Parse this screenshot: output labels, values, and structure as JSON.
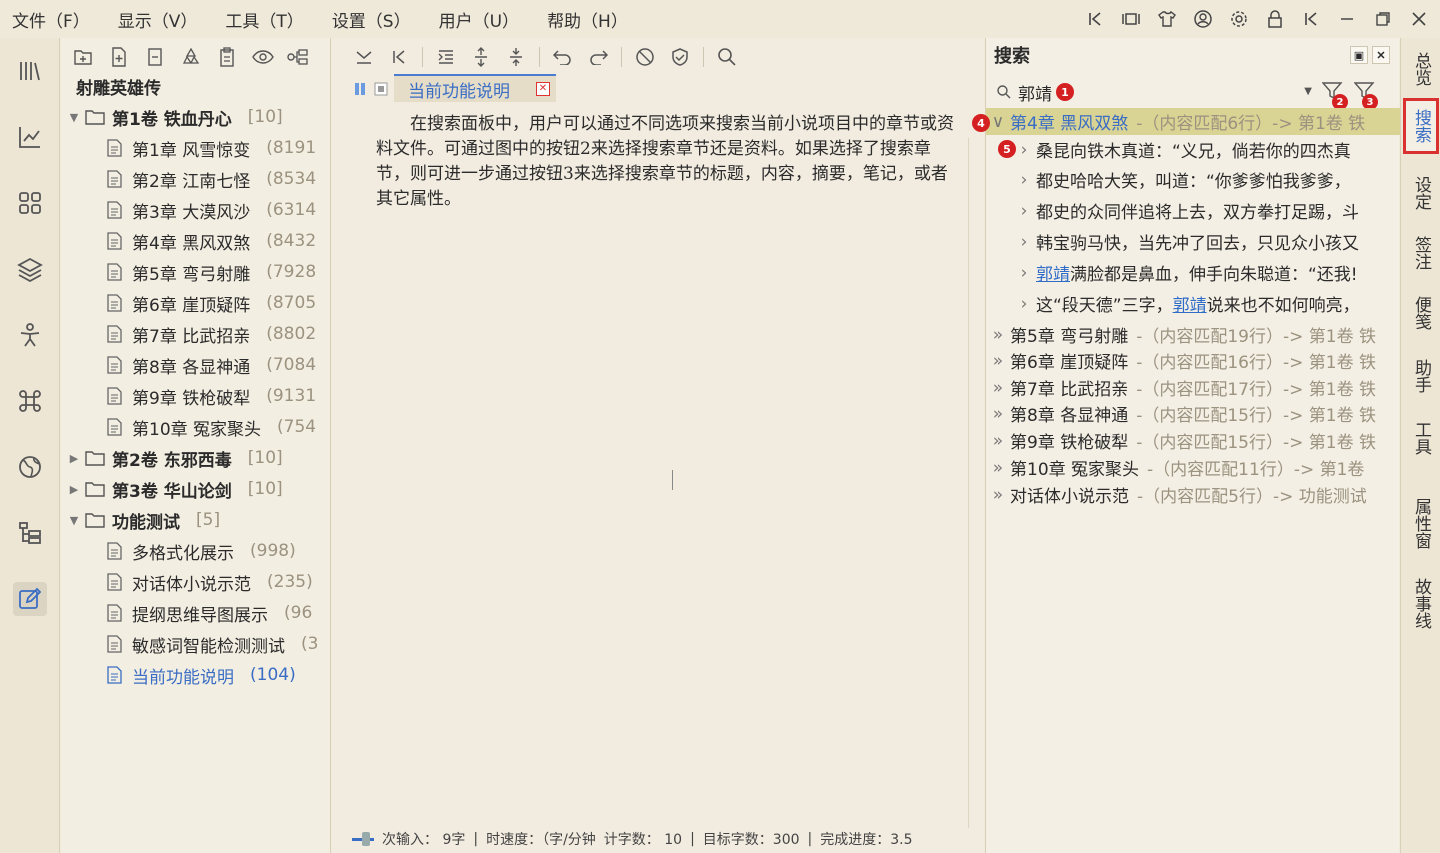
{
  "menubar": {
    "items": [
      "文件（F）",
      "显示（V）",
      "工具（T）",
      "设置（S）",
      "用户（U）",
      "帮助（H）"
    ]
  },
  "window_controls": [
    "collapse-left-icon",
    "fullscreen-icon",
    "theme-icon",
    "user-icon",
    "settings-icon",
    "lock-icon",
    "collapse-icon",
    "minimize-icon",
    "restore-icon",
    "close-icon"
  ],
  "left_rail": {
    "icons": [
      "library-icon",
      "chart-icon",
      "grid-icon",
      "layers-icon",
      "character-icon",
      "command-icon",
      "globe-icon",
      "outline-icon",
      "edit-icon"
    ]
  },
  "tree": {
    "title": "射雕英雄传",
    "rows": [
      {
        "level": 0,
        "type": "volume",
        "expanded": true,
        "label": "第1卷 铁血丹心",
        "count": "[10]"
      },
      {
        "level": 1,
        "type": "doc",
        "label": "第1章 风雪惊变",
        "count": "(8191"
      },
      {
        "level": 1,
        "type": "doc",
        "label": "第2章 江南七怪",
        "count": "(8534"
      },
      {
        "level": 1,
        "type": "doc",
        "label": "第3章 大漠风沙",
        "count": "(6314"
      },
      {
        "level": 1,
        "type": "doc",
        "label": "第4章 黑风双煞",
        "count": "(8432"
      },
      {
        "level": 1,
        "type": "doc",
        "label": "第5章 弯弓射雕",
        "count": "(7928"
      },
      {
        "level": 1,
        "type": "doc",
        "label": "第6章 崖顶疑阵",
        "count": "(8705"
      },
      {
        "level": 1,
        "type": "doc",
        "label": "第7章 比武招亲",
        "count": "(8802"
      },
      {
        "level": 1,
        "type": "doc",
        "label": "第8章 各显神通",
        "count": "(7084"
      },
      {
        "level": 1,
        "type": "doc",
        "label": "第9章 铁枪破犁",
        "count": "(9131"
      },
      {
        "level": 1,
        "type": "doc",
        "label": "第10章 冤家聚头",
        "count": "(754"
      },
      {
        "level": 0,
        "type": "volume",
        "expanded": false,
        "label": "第2卷 东邪西毒",
        "count": "[10]"
      },
      {
        "level": 0,
        "type": "volume",
        "expanded": false,
        "label": "第3卷 华山论剑",
        "count": "[10]"
      },
      {
        "level": 0,
        "type": "volume",
        "expanded": true,
        "label": "功能测试",
        "count": "[5]"
      },
      {
        "level": 1,
        "type": "doc",
        "label": "多格式化展示",
        "count": "(998)"
      },
      {
        "level": 1,
        "type": "doc",
        "label": "对话体小说示范",
        "count": "(235)"
      },
      {
        "level": 1,
        "type": "doc",
        "label": "提纲思维导图展示",
        "count": "(96"
      },
      {
        "level": 1,
        "type": "doc",
        "label": "敏感词智能检测测试",
        "count": "(3"
      },
      {
        "level": 1,
        "type": "doc",
        "label": "当前功能说明",
        "count": "(104)",
        "selected": true
      }
    ]
  },
  "editor": {
    "tab_label": "当前功能说明",
    "body": "在搜索面板中，用户可以通过不同选项来搜索当前小说项目中的章节或资料文件。可通过图中的按钮2来选择搜索章节还是资料。如果选择了搜索章节，则可进一步通过按钮3来选择搜索章节的标题，内容，摘要，笔记，或者其它属性。",
    "status": {
      "input": "次输入： 9字",
      "speed": "时速度：（字/分钟",
      "total": "计字数： 10",
      "target": "目标字数：300",
      "progress": "完成进度：3.5"
    }
  },
  "search": {
    "title": "搜索",
    "query": "郭靖",
    "badges": [
      "1",
      "2",
      "3",
      "4",
      "5"
    ],
    "results": [
      {
        "kind": "chapter",
        "expanded": true,
        "highlight": true,
        "title": "第4章 黑风双煞",
        "meta": "-（内容匹配6行）-> 第1卷 铁"
      },
      {
        "kind": "line",
        "expanded": true,
        "text_a": "桑昆向铁木真道：“义兄，倘若你的四杰真",
        "link": "",
        "text_b": ""
      },
      {
        "kind": "line",
        "text_a": "都史哈哈大笑，叫道：“你爹爹怕我爹爹，",
        "link": "",
        "text_b": ""
      },
      {
        "kind": "line",
        "text_a": "都史的众同伴追将上去，双方拳打足踢，斗",
        "link": "",
        "text_b": ""
      },
      {
        "kind": "line",
        "text_a": "韩宝驹马快，当先冲了回去，只见众小孩又",
        "link": "",
        "text_b": ""
      },
      {
        "kind": "line",
        "text_a": "",
        "link": "郭靖",
        "text_b": "满脸都是鼻血，伸手向朱聪道：“还我!"
      },
      {
        "kind": "line",
        "text_a": "这“段天德”三字，",
        "link": "郭靖",
        "text_b": "说来也不如何响亮，"
      },
      {
        "kind": "chapter",
        "title": "第5章 弯弓射雕",
        "meta": "-（内容匹配19行）-> 第1卷 铁"
      },
      {
        "kind": "chapter",
        "title": "第6章 崖顶疑阵",
        "meta": "-（内容匹配16行）-> 第1卷 铁"
      },
      {
        "kind": "chapter",
        "title": "第7章 比武招亲",
        "meta": "-（内容匹配17行）-> 第1卷 铁"
      },
      {
        "kind": "chapter",
        "title": "第8章 各显神通",
        "meta": "-（内容匹配15行）-> 第1卷 铁"
      },
      {
        "kind": "chapter",
        "title": "第9章 铁枪破犁",
        "meta": "-（内容匹配15行）-> 第1卷 铁"
      },
      {
        "kind": "chapter",
        "title": "第10章 冤家聚头",
        "meta": "-（内容匹配11行）-> 第1卷"
      },
      {
        "kind": "chapter",
        "title": "对话体小说示范",
        "meta": "-（内容匹配5行）-> 功能测试"
      }
    ]
  },
  "right_tabs": [
    {
      "label": "总览",
      "active": false
    },
    {
      "label": "搜索",
      "active": true
    },
    {
      "label": "设定",
      "active": false
    },
    {
      "label": "签注",
      "active": false
    },
    {
      "label": "便笺",
      "active": false
    },
    {
      "label": "助手",
      "active": false
    },
    {
      "label": "工具",
      "active": false
    },
    {
      "label": "属性窗",
      "active": false
    },
    {
      "label": "故事线",
      "active": false
    }
  ],
  "colors": {
    "accent": "#3a6dc4",
    "highlight": "#d9d394",
    "badge": "#d42020",
    "active_tab_border": "#d93030"
  }
}
